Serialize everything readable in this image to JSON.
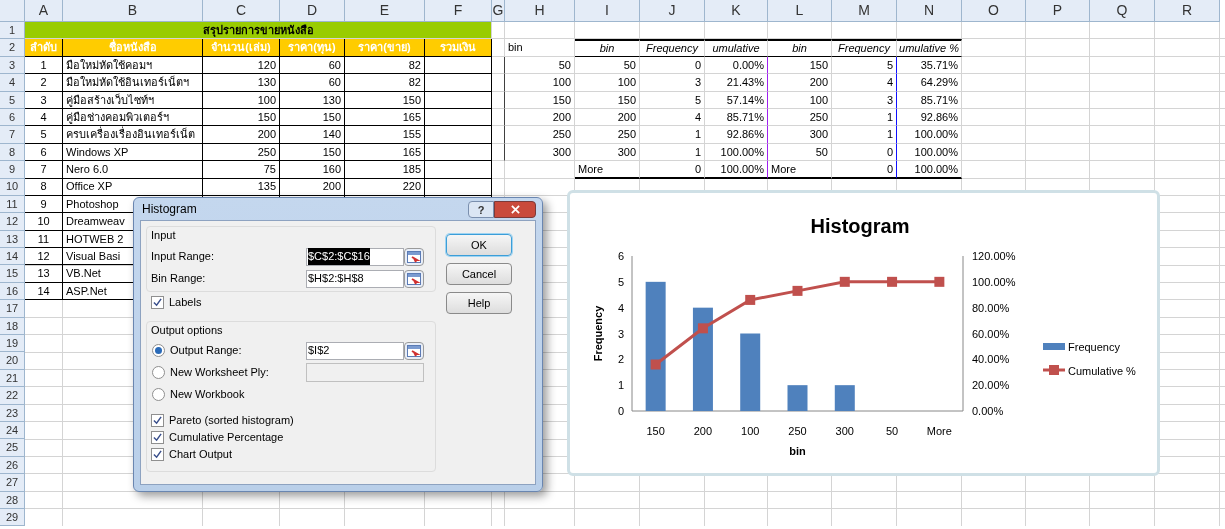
{
  "sheet": {
    "columns": [
      "A",
      "B",
      "C",
      "D",
      "E",
      "F",
      "G",
      "H",
      "I",
      "J",
      "K",
      "L",
      "M",
      "N",
      "O",
      "P",
      "Q",
      "R"
    ],
    "rows": [
      {
        "number": "1",
        "kind": "title",
        "cells": [
          "สรุปรายการขายหนังสือ"
        ]
      },
      {
        "number": "2",
        "kind": "header",
        "cells": [
          "ลำดับ",
          "ชื่อหนังสือ",
          "จำนวน(เล่ม)",
          "ราคา(ทุน)",
          "ราคา(ขาย)",
          "รวมเงิน",
          "",
          "bin",
          "bin",
          "Frequency",
          "umulative",
          "bin",
          "Frequency",
          "umulative %"
        ]
      },
      {
        "number": "3",
        "kind": "data",
        "cells": [
          "1",
          "มือใหม่หัดใช้คอมฯ",
          "120",
          "60",
          "82",
          "",
          "",
          "50",
          "50",
          "0",
          "0.00%",
          "150",
          "5",
          "35.71%"
        ]
      },
      {
        "number": "4",
        "kind": "data",
        "cells": [
          "2",
          "มือใหม่หัดใช้อินเทอร์เน็ตฯ",
          "130",
          "60",
          "82",
          "",
          "",
          "100",
          "100",
          "3",
          "21.43%",
          "200",
          "4",
          "64.29%"
        ]
      },
      {
        "number": "5",
        "kind": "data",
        "cells": [
          "3",
          "คู่มือสร้างเว็บไซท์ฯ",
          "100",
          "130",
          "150",
          "",
          "",
          "150",
          "150",
          "5",
          "57.14%",
          "100",
          "3",
          "85.71%"
        ]
      },
      {
        "number": "6",
        "kind": "data",
        "cells": [
          "4",
          "คู่มือช่างคอมพิวเตอร์ฯ",
          "150",
          "150",
          "165",
          "",
          "",
          "200",
          "200",
          "4",
          "85.71%",
          "250",
          "1",
          "92.86%"
        ]
      },
      {
        "number": "7",
        "kind": "data",
        "cells": [
          "5",
          "ครบเครื่องเรื่องอินเทอร์เน็ต",
          "200",
          "140",
          "155",
          "",
          "",
          "250",
          "250",
          "1",
          "92.86%",
          "300",
          "1",
          "100.00%"
        ]
      },
      {
        "number": "8",
        "kind": "data",
        "cells": [
          "6",
          "Windows XP",
          "250",
          "150",
          "165",
          "",
          "",
          "300",
          "300",
          "1",
          "100.00%",
          "50",
          "0",
          "100.00%"
        ]
      },
      {
        "number": "9",
        "kind": "data",
        "cells": [
          "7",
          "Nero 6.0",
          "75",
          "160",
          "185",
          "",
          "",
          "",
          {
            "text": "More",
            "kind": "label"
          },
          "0",
          "100.00%",
          {
            "text": "More",
            "kind": "label"
          },
          "0",
          "100.00%"
        ]
      },
      {
        "number": "10",
        "kind": "data",
        "cells": [
          "8",
          "Office XP",
          "135",
          "200",
          "220"
        ]
      },
      {
        "number": "11",
        "kind": "data",
        "cells": [
          "9",
          "Photoshop"
        ]
      },
      {
        "number": "12",
        "kind": "data",
        "cells": [
          "10",
          "Dreamweav"
        ]
      },
      {
        "number": "13",
        "kind": "data",
        "cells": [
          "11",
          "HOTWEB 2"
        ]
      },
      {
        "number": "14",
        "kind": "data",
        "cells": [
          "12",
          "Visual Basi"
        ]
      },
      {
        "number": "15",
        "kind": "data",
        "cells": [
          "13",
          "VB.Net"
        ]
      },
      {
        "number": "16",
        "kind": "data",
        "cells": [
          "14",
          "ASP.Net"
        ]
      },
      {
        "number": "17",
        "kind": "blank"
      },
      {
        "number": "18",
        "kind": "blank"
      },
      {
        "number": "19",
        "kind": "blank"
      },
      {
        "number": "20",
        "kind": "blank"
      },
      {
        "number": "21",
        "kind": "blank"
      },
      {
        "number": "22",
        "kind": "blank"
      },
      {
        "number": "23",
        "kind": "blank"
      },
      {
        "number": "24",
        "kind": "blank"
      },
      {
        "number": "25",
        "kind": "blank"
      },
      {
        "number": "26",
        "kind": "blank"
      },
      {
        "number": "27",
        "kind": "blank"
      },
      {
        "number": "28",
        "kind": "blank"
      },
      {
        "number": "29",
        "kind": "blank"
      }
    ]
  },
  "dialog": {
    "title": "Histogram",
    "help_button": "?",
    "input_group": {
      "label": "Input",
      "fields": [
        {
          "label": "Input Range:",
          "value": "$C$2:$C$16",
          "highlighted": true
        },
        {
          "label": "Bin Range:",
          "value": "$H$2:$H$8",
          "highlighted": false
        }
      ]
    },
    "labels_checkbox": {
      "label": "Labels",
      "checked": true
    },
    "output_group": {
      "label": "Output options",
      "options": [
        {
          "label": "Output Range:",
          "selected": true,
          "field": {
            "value": "$I$2",
            "disabled": false
          }
        },
        {
          "label": "New Worksheet Ply:",
          "selected": false,
          "field": {
            "disabled": true
          }
        },
        {
          "label": "New Workbook",
          "selected": false
        }
      ],
      "checkboxes": [
        {
          "label": "Pareto (sorted histogram)",
          "checked": true
        },
        {
          "label": "Cumulative Percentage",
          "checked": true
        },
        {
          "label": "Chart Output",
          "checked": true
        }
      ]
    },
    "buttons": [
      {
        "label": "OK",
        "default": true
      },
      {
        "label": "Cancel",
        "default": false
      },
      {
        "label": "Help",
        "default": false
      }
    ]
  },
  "chart": {
    "chart_data": {
      "type": "bar",
      "title": "Histogram",
      "xlabel": "bin",
      "ylabel": "Frequency",
      "categories": [
        "150",
        "200",
        "100",
        "250",
        "300",
        "50",
        "More"
      ],
      "series": [
        {
          "name": "Frequency",
          "color": "#4f81bd",
          "values": [
            5,
            4,
            3,
            1,
            1,
            0,
            0
          ]
        },
        {
          "name": "Cumulative %",
          "type": "line",
          "axis": "y2",
          "marker": "square",
          "color": "#c0504d",
          "values": [
            0.36,
            0.64,
            0.86,
            0.93,
            1,
            1,
            1
          ]
        }
      ],
      "legend": "right",
      "ylim": [
        0,
        6
      ],
      "yticks": [
        0,
        1,
        2,
        3,
        4,
        5,
        6
      ],
      "y2lim": [
        0,
        1.2
      ],
      "y2ticks": [
        {
          "value": 0,
          "label": "0.00%"
        },
        {
          "value": 0.2,
          "label": "20.00%"
        },
        {
          "value": 0.4,
          "label": "40.00%"
        },
        {
          "value": 0.6,
          "label": "60.00%"
        },
        {
          "value": 0.8,
          "label": "80.00%"
        },
        {
          "value": 1,
          "label": "100.00%"
        },
        {
          "value": 1.2,
          "label": "120.00%"
        }
      ]
    }
  }
}
